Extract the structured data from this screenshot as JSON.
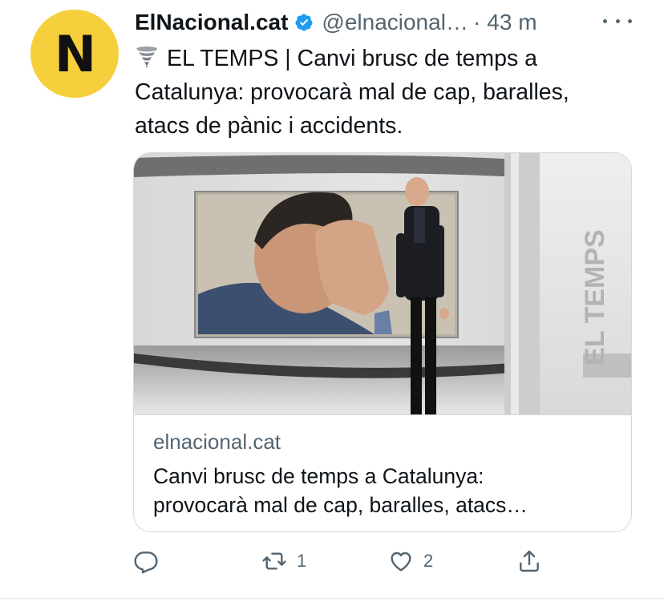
{
  "account": {
    "avatar_letter": "N",
    "name": "ElNacional.cat",
    "handle": "@elnacional…",
    "separator": "·",
    "time": "43 m",
    "verified_icon": "verified-badge-icon",
    "more_icon": "more-options-icon"
  },
  "tweet": {
    "emoji_icon": "tornado-icon",
    "text_line1": "EL TEMPS | Canvi brusc de temps a",
    "text_line2": "Catalunya: provocarà mal de cap, baralles,",
    "text_line3": "atacs de pànic i accidents."
  },
  "card": {
    "image_overlay_text": "EL TEMPS",
    "domain": "elnacional.cat",
    "title_line1": "Canvi brusc de temps a Catalunya:",
    "title_line2": "provocarà mal de cap, baralles, atacs…"
  },
  "actions": {
    "reply_icon": "reply-icon",
    "retweet_icon": "retweet-icon",
    "retweet_count": "1",
    "like_icon": "like-icon",
    "like_count": "2",
    "share_icon": "share-icon"
  },
  "colors": {
    "avatar_bg": "#f6cf3c",
    "verified": "#1d9bf0",
    "secondary_text": "#536471",
    "border": "#cfd9de"
  }
}
